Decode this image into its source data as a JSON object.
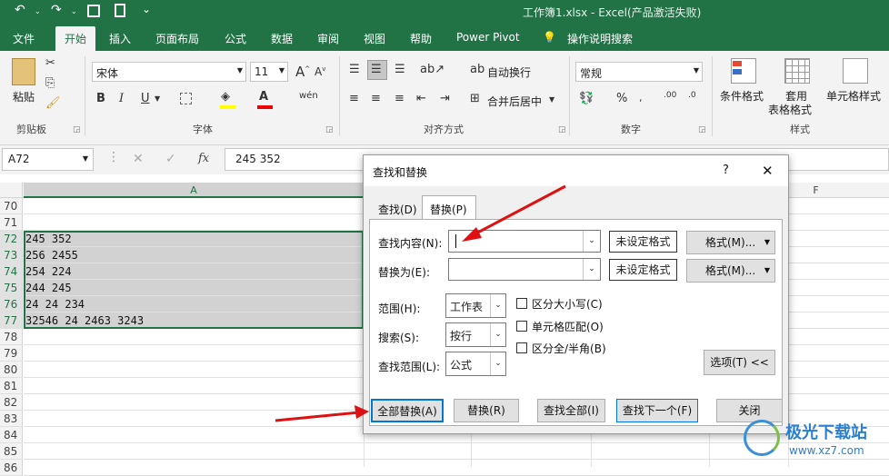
{
  "window": {
    "title": "工作簿1.xlsx  -  Excel(产品激活失败)"
  },
  "quick_access": {
    "undo": "↶",
    "redo": "↷",
    "save": "💾",
    "preview": "🔍",
    "customize": "⌄"
  },
  "tabs": [
    "文件",
    "开始",
    "插入",
    "页面布局",
    "公式",
    "数据",
    "审阅",
    "视图",
    "帮助",
    "Power Pivot",
    "操作说明搜索"
  ],
  "ribbon": {
    "clipboard": {
      "paste": "粘贴",
      "label": "剪贴板"
    },
    "font": {
      "name": "宋体",
      "size": "11",
      "bold": "B",
      "italic": "I",
      "underline": "U",
      "wen": "wén",
      "label": "字体"
    },
    "align": {
      "wrap": "自动换行",
      "merge": "合并后居中",
      "label": "对齐方式"
    },
    "number": {
      "format": "常规",
      "percent": "%",
      "label": "数字"
    },
    "styles": {
      "conditional": "条件格式",
      "table": "套用",
      "table2": "表格格式",
      "cell": "单元格样式",
      "label": "样式"
    }
  },
  "formula_bar": {
    "namebox": "A72",
    "cancel": "✕",
    "enter": "✓",
    "fx": "fx",
    "value": "245 352"
  },
  "columns": {
    "a": "A",
    "f": "F"
  },
  "rows": [
    {
      "num": "70",
      "a": ""
    },
    {
      "num": "71",
      "a": ""
    },
    {
      "num": "72",
      "a": "245  352"
    },
    {
      "num": "73",
      "a": "256  2455"
    },
    {
      "num": "74",
      "a": "254  224"
    },
    {
      "num": "75",
      "a": "244   245"
    },
    {
      "num": "76",
      "a": "24  24  234"
    },
    {
      "num": "77",
      "a": " 32546  24  2463  3243"
    },
    {
      "num": "78",
      "a": ""
    },
    {
      "num": "79",
      "a": ""
    },
    {
      "num": "80",
      "a": ""
    },
    {
      "num": "81",
      "a": ""
    },
    {
      "num": "82",
      "a": ""
    },
    {
      "num": "83",
      "a": ""
    },
    {
      "num": "84",
      "a": ""
    },
    {
      "num": "85",
      "a": ""
    },
    {
      "num": "86",
      "a": ""
    }
  ],
  "dialog": {
    "title": "查找和替换",
    "help": "?",
    "close": "✕",
    "tab_find": "查找(D)",
    "tab_replace": "替换(P)",
    "find_label": "查找内容(N):",
    "find_value": "",
    "replace_label": "替换为(E):",
    "replace_value": "",
    "no_format": "未设定格式",
    "format_btn": "格式(M)...",
    "scope_label": "范围(H):",
    "scope_value": "工作表",
    "search_label": "搜索(S):",
    "search_value": "按行",
    "lookin_label": "查找范围(L):",
    "lookin_value": "公式",
    "match_case": "区分大小写(C)",
    "match_cell": "单元格匹配(O)",
    "match_width": "区分全/半角(B)",
    "options": "选项(T) <<",
    "replace_all": "全部替换(A)",
    "replace": "替换(R)",
    "find_all": "查找全部(I)",
    "find_next": "查找下一个(F)",
    "close_btn": "关闭"
  },
  "watermark": {
    "cn": "极光下载站",
    "url": "www.xz7.com"
  },
  "colors": {
    "excel_green": "#217346",
    "annotation_red": "#dd1111",
    "focus_blue": "#0078d7"
  }
}
